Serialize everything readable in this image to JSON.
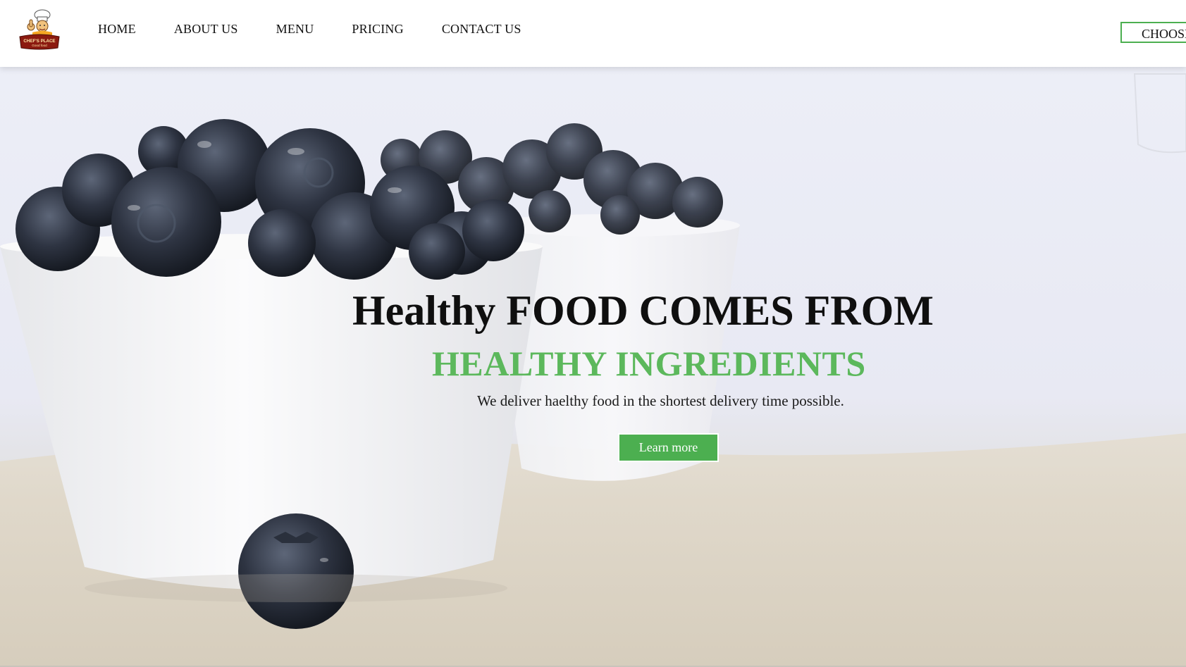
{
  "brand": {
    "logo_text_top": "CHEF'S PLACE",
    "logo_text_bottom": "Good food"
  },
  "nav": {
    "items": [
      {
        "label": "HOME"
      },
      {
        "label": "ABOUT US"
      },
      {
        "label": "MENU"
      },
      {
        "label": "PRICING"
      },
      {
        "label": "CONTACT US"
      }
    ],
    "cta_label": "CHOOSE"
  },
  "hero": {
    "headline": "Healthy FOOD COMES FROM",
    "subheadline": "HEALTHY INGREDIENTS",
    "tagline": "We deliver haelthy food in the shortest delivery time possible.",
    "button_label": "Learn more"
  },
  "colors": {
    "accent": "#4caf50",
    "headline": "#0f0f0f",
    "subheadline": "#5cb85c"
  }
}
